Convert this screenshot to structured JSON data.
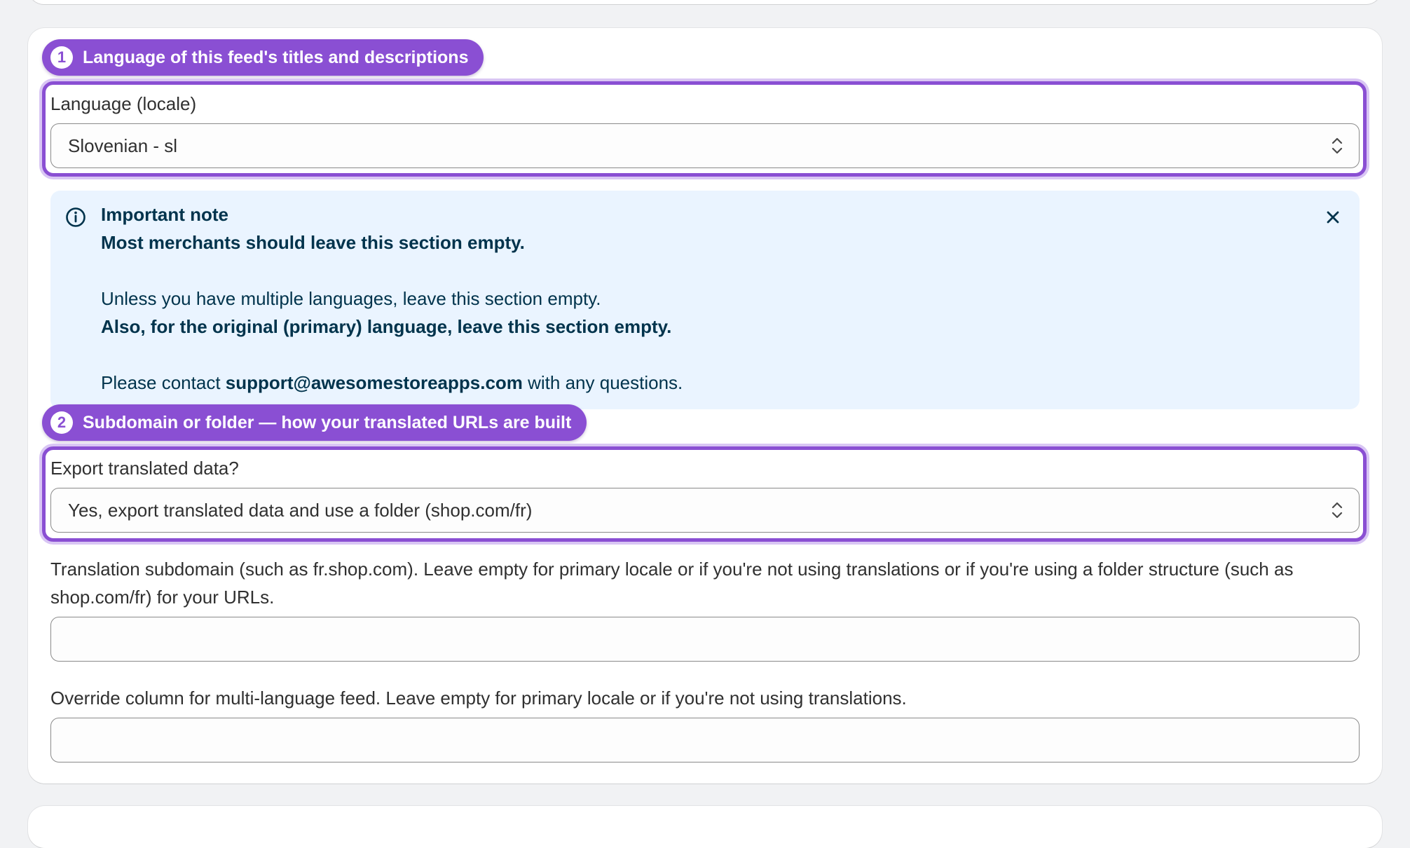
{
  "section1": {
    "number": "1",
    "title": "Language of this feed's titles and descriptions",
    "field_label": "Language (locale)",
    "selected_value": "Slovenian - sl"
  },
  "note": {
    "title": "Important note",
    "line1": "Most merchants should leave this section empty.",
    "line2": "Unless you have multiple languages, leave this section empty.",
    "line3": "Also, for the original (primary) language, leave this section empty.",
    "contact_prefix": "Please contact ",
    "contact_email": "support@awesomestoreapps.com",
    "contact_suffix": " with any questions."
  },
  "section2": {
    "number": "2",
    "title": "Subdomain or folder — how your translated URLs are built",
    "field_label": "Export translated data?",
    "selected_value": "Yes, export translated data and use a folder (shop.com/fr)"
  },
  "subdomain_field": {
    "label": "Translation subdomain (such as fr.shop.com). Leave empty for primary locale or if you're not using translations or if you're using a folder structure (such as shop.com/fr) for your URLs.",
    "value": ""
  },
  "override_field": {
    "label": "Override column for multi-language feed. Leave empty for primary locale or if you're not using translations.",
    "value": ""
  },
  "colors": {
    "accent": "#8a4fd3",
    "note_bg": "#eaf4ff",
    "note_text": "#00334c"
  },
  "icons": [
    "info-icon",
    "close-icon",
    "select-chevron-icon"
  ]
}
